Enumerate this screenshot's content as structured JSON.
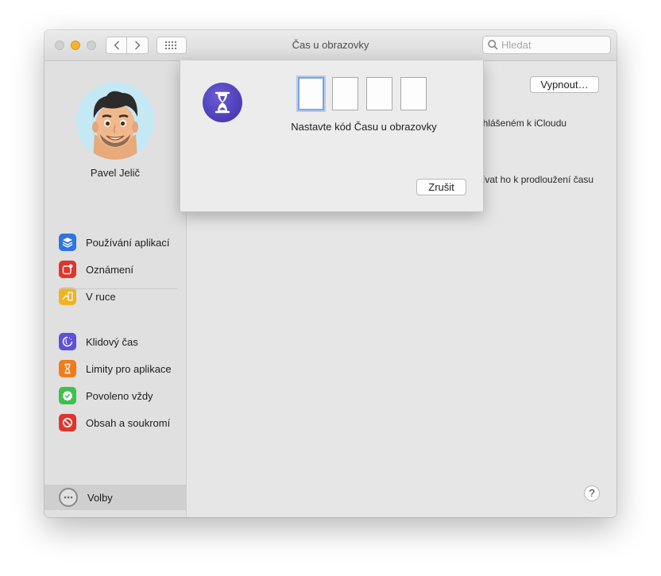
{
  "window": {
    "title": "Čas u obrazovky",
    "search_placeholder": "Hledat"
  },
  "sidebar": {
    "user_name": "Pavel Jelič",
    "group1": [
      {
        "label": "Používání aplikací",
        "icon": "layers-icon",
        "color": "#2f74e0"
      },
      {
        "label": "Oznámení",
        "icon": "notification-icon",
        "color": "#e0352b"
      },
      {
        "label": "V ruce",
        "icon": "pickup-icon",
        "color": "#f0b321"
      }
    ],
    "group2": [
      {
        "label": "Klidový čas",
        "icon": "downtime-icon",
        "color": "#5e50d8"
      },
      {
        "label": "Limity pro aplikace",
        "icon": "hourglass-icon",
        "color": "#f07d1a"
      },
      {
        "label": "Povoleno vždy",
        "icon": "checkmark-badge-icon",
        "color": "#3ec04c"
      },
      {
        "label": "Obsah a soukromí",
        "icon": "restriction-icon",
        "color": "#e0352b"
      }
    ],
    "options_label": "Volby"
  },
  "main": {
    "vypnout_label": "Vypnout…",
    "text1": "řihlášeném k iCloudu",
    "text2": "žívat ho k prodloužení času",
    "help_label": "?"
  },
  "sheet": {
    "prompt": "Nastavte kód Času u obrazovky",
    "cancel_label": "Zrušit",
    "code_digits": [
      "",
      "",
      "",
      ""
    ]
  }
}
